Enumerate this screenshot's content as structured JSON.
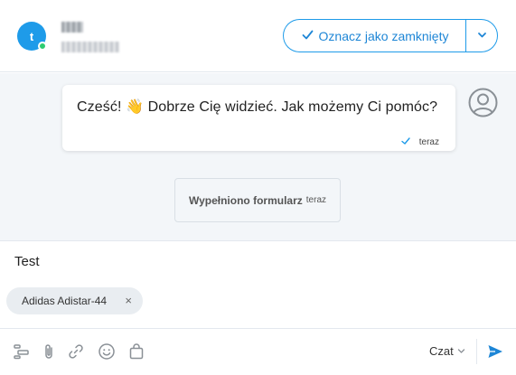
{
  "header": {
    "avatar_letter": "t",
    "close_label": "Oznacz jako zamknięty",
    "accent_color": "#1e9be9"
  },
  "chat": {
    "greeting": "Cześć! 👋 Dobrze Cię widzieć. Jak możemy Ci pomóc?",
    "greeting_time": "teraz",
    "form_event": "Wypełniono formularz",
    "form_event_time": "teraz"
  },
  "composer": {
    "text": "Test",
    "chip_label": "Adidas Adistar-44",
    "channel_label": "Czat"
  },
  "icons": [
    "avatar",
    "check-icon",
    "chevron-down-icon",
    "user-circle-icon",
    "template-icon",
    "paperclip-icon",
    "link-icon",
    "smiley-icon",
    "shopping-bag-icon",
    "send-icon"
  ]
}
